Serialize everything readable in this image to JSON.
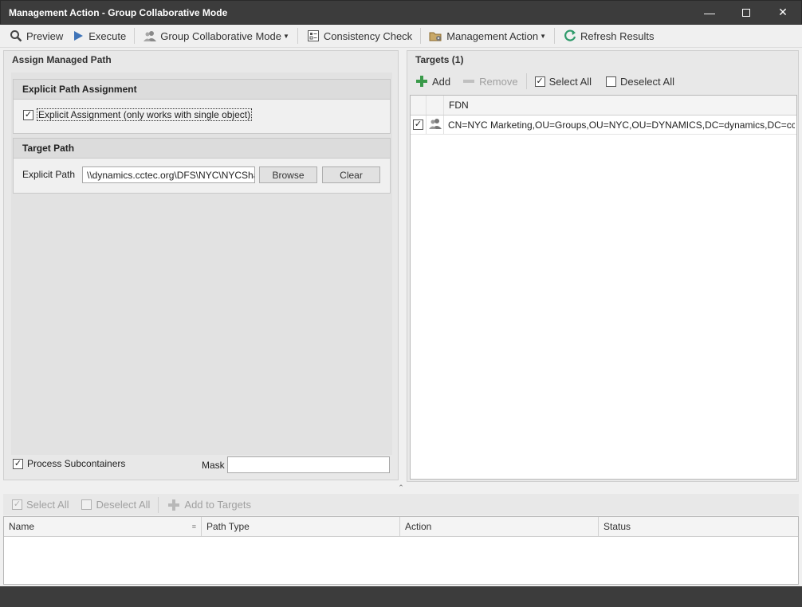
{
  "window": {
    "title": "Management Action - Group Collaborative Mode"
  },
  "toolbar": {
    "preview": "Preview",
    "execute": "Execute",
    "collab_mode": "Group Collaborative Mode",
    "consistency_check": "Consistency Check",
    "management_action": "Management Action",
    "refresh_results": "Refresh Results"
  },
  "left": {
    "title": "Assign Managed Path",
    "explicit_group": {
      "title": "Explicit Path Assignment",
      "checkbox_label": "Explicit Assignment (only works with single object)",
      "checked": true
    },
    "target_group": {
      "title": "Target Path",
      "path_label": "Explicit Path",
      "path_value": "\\\\dynamics.cctec.org\\DFS\\NYC\\NYCShare",
      "browse": "Browse",
      "clear": "Clear"
    },
    "process_subcontainers": "Process Subcontainers",
    "process_checked": true,
    "mask_label": "Mask",
    "mask_value": ""
  },
  "right": {
    "title": "Targets (1)",
    "add": "Add",
    "remove": "Remove",
    "select_all": "Select All",
    "deselect_all": "Deselect All",
    "columns": [
      "FDN"
    ],
    "rows": [
      {
        "fdn": "CN=NYC Marketing,OU=Groups,OU=NYC,OU=DYNAMICS,DC=dynamics,DC=cctec,...",
        "checked": true
      }
    ]
  },
  "bottom": {
    "select_all": "Select All",
    "deselect_all": "Deselect All",
    "add_to_targets": "Add to Targets",
    "columns": [
      "Name",
      "Path Type",
      "Action",
      "Status"
    ]
  },
  "colors": {
    "titlebar": "#3c3c3c",
    "add_green": "#3a9a4a",
    "execute_blue": "#3f74b8",
    "refresh_green": "#2e9a6a"
  }
}
